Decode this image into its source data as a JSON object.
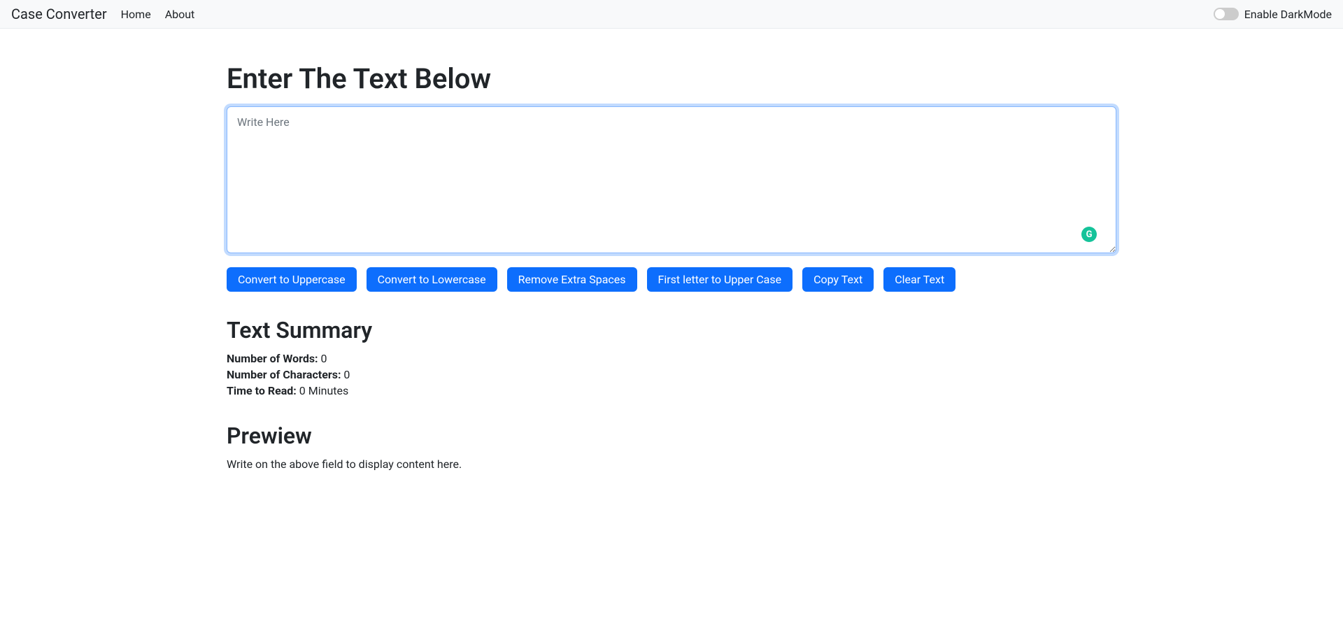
{
  "navbar": {
    "brand": "Case Converter",
    "links": {
      "home": "Home",
      "about": "About"
    },
    "darkmode_label": "Enable DarkMode"
  },
  "main": {
    "heading": "Enter The Text Below",
    "textarea_placeholder": "Write Here",
    "textarea_value": "",
    "grammarly_icon_letter": "G",
    "buttons": {
      "uppercase": "Convert to Uppercase",
      "lowercase": "Convert to Lowercase",
      "remove_spaces": "Remove Extra Spaces",
      "first_upper": "First letter to Upper Case",
      "copy": "Copy Text",
      "clear": "Clear Text"
    }
  },
  "summary": {
    "heading": "Text Summary",
    "words_label": "Number of Words:",
    "words_value": "0",
    "chars_label": "Number of Characters:",
    "chars_value": "0",
    "time_label": "Time to Read:",
    "time_value": "0 Minutes"
  },
  "preview": {
    "heading": "Prewiew",
    "empty_text": "Write on the above field to display content here."
  }
}
